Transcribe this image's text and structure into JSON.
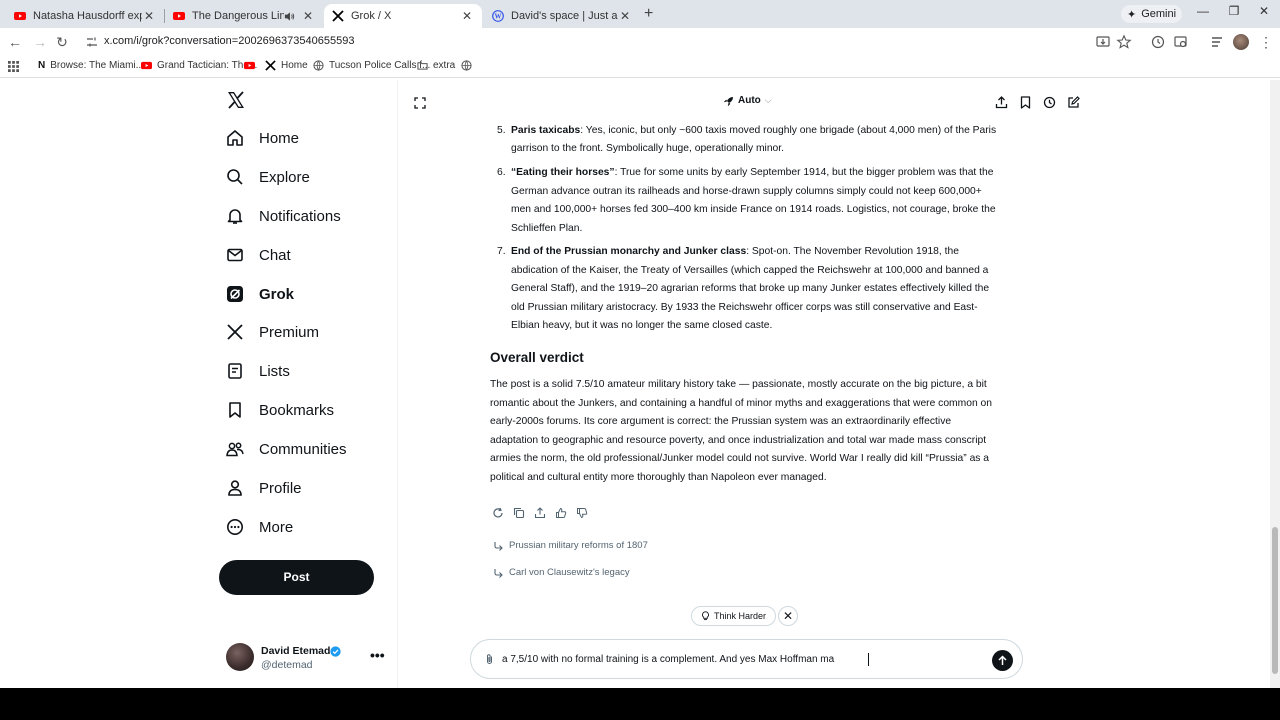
{
  "browser": {
    "tabs": [
      {
        "title": "Natasha Hausdorff explains the",
        "favicon": "youtube-icon"
      },
      {
        "title": "The Dangerous Line The U.S",
        "favicon": "youtube-icon"
      },
      {
        "title": "Grok / X",
        "favicon": "x-icon",
        "active": true
      },
      {
        "title": "David's space | Just another W",
        "favicon": "wordpress-icon"
      }
    ],
    "gemini_label": "Gemini",
    "url": "x.com/i/grok?conversation=2002696373540655593",
    "bookmarks": [
      {
        "label": "Browse: The Miami...",
        "icon": "n-icon"
      },
      {
        "label": "Grand Tactician: The...",
        "icon": "youtube-icon"
      },
      {
        "label": "",
        "icon": "youtube-icon"
      },
      {
        "label": "Home",
        "icon": "x-icon"
      },
      {
        "label": "Tucson Police Calls f...",
        "icon": "globe-icon"
      },
      {
        "label": "extra",
        "icon": "folder-icon"
      },
      {
        "label": "",
        "icon": "globe-icon"
      }
    ]
  },
  "nav": {
    "items": [
      {
        "label": "Home",
        "icon": "home-icon"
      },
      {
        "label": "Explore",
        "icon": "search-icon"
      },
      {
        "label": "Notifications",
        "icon": "bell-icon"
      },
      {
        "label": "Chat",
        "icon": "mail-icon"
      },
      {
        "label": "Grok",
        "icon": "grok-icon",
        "active": true
      },
      {
        "label": "Premium",
        "icon": "x-icon"
      },
      {
        "label": "Lists",
        "icon": "list-icon"
      },
      {
        "label": "Bookmarks",
        "icon": "bookmark-icon"
      },
      {
        "label": "Communities",
        "icon": "people-icon"
      },
      {
        "label": "Profile",
        "icon": "person-icon"
      },
      {
        "label": "More",
        "icon": "more-circle-icon"
      }
    ],
    "post_label": "Post",
    "account": {
      "name": "David Etemad",
      "handle": "@detemad",
      "more": "•••"
    }
  },
  "header": {
    "model": "Auto"
  },
  "answer": {
    "items": [
      {
        "num": "5.",
        "bold": "Paris taxicabs",
        "text": ": Yes, iconic, but only ~600 taxis moved roughly one brigade (about 4,000 men) of the Paris garrison to the front. Symbolically huge, operationally minor."
      },
      {
        "num": "6.",
        "bold": "“Eating their horses”",
        "text": ": True for some units by early September 1914, but the bigger problem was that the German advance outran its railheads and horse-drawn supply columns simply could not keep 600,000+ men and 100,000+ horses fed 300–400 km inside France on 1914 roads. Logistics, not courage, broke the Schlieffen Plan."
      },
      {
        "num": "7.",
        "bold": "End of the Prussian monarchy and Junker class",
        "text": ": Spot-on. The November Revolution 1918, the abdication of the Kaiser, the Treaty of Versailles (which capped the Reichswehr at 100,000 and banned a General Staff), and the 1919–20 agrarian reforms that broke up many Junker estates effectively killed the old Prussian military aristocracy. By 1933 the Reichswehr officer corps was still conservative and East-Elbian heavy, but it was no longer the same closed caste."
      }
    ],
    "verdict_heading": "Overall verdict",
    "verdict_text": "The post is a solid 7.5/10 amateur military history take — passionate, mostly accurate on the big picture, a bit romantic about the Junkers, and containing a handful of minor myths and exaggerations that were common on early-2000s forums. Its core argument is correct: the Prussian system was an extraordinarily effective adaptation to geographic and resource poverty, and once industrialization and total war made mass conscript armies the norm, the old professional/Junker model could not survive. World War I really did kill “Prussia” as a political and cultural entity more thoroughly than Napoleon ever managed."
  },
  "followups": [
    "Prussian military reforms of 1807",
    "Carl von Clausewitz's legacy"
  ],
  "think_harder_label": "Think Harder",
  "composer": {
    "value": "a 7,5/10 with no formal training is a complement. And yes Max Hoffman ma"
  }
}
